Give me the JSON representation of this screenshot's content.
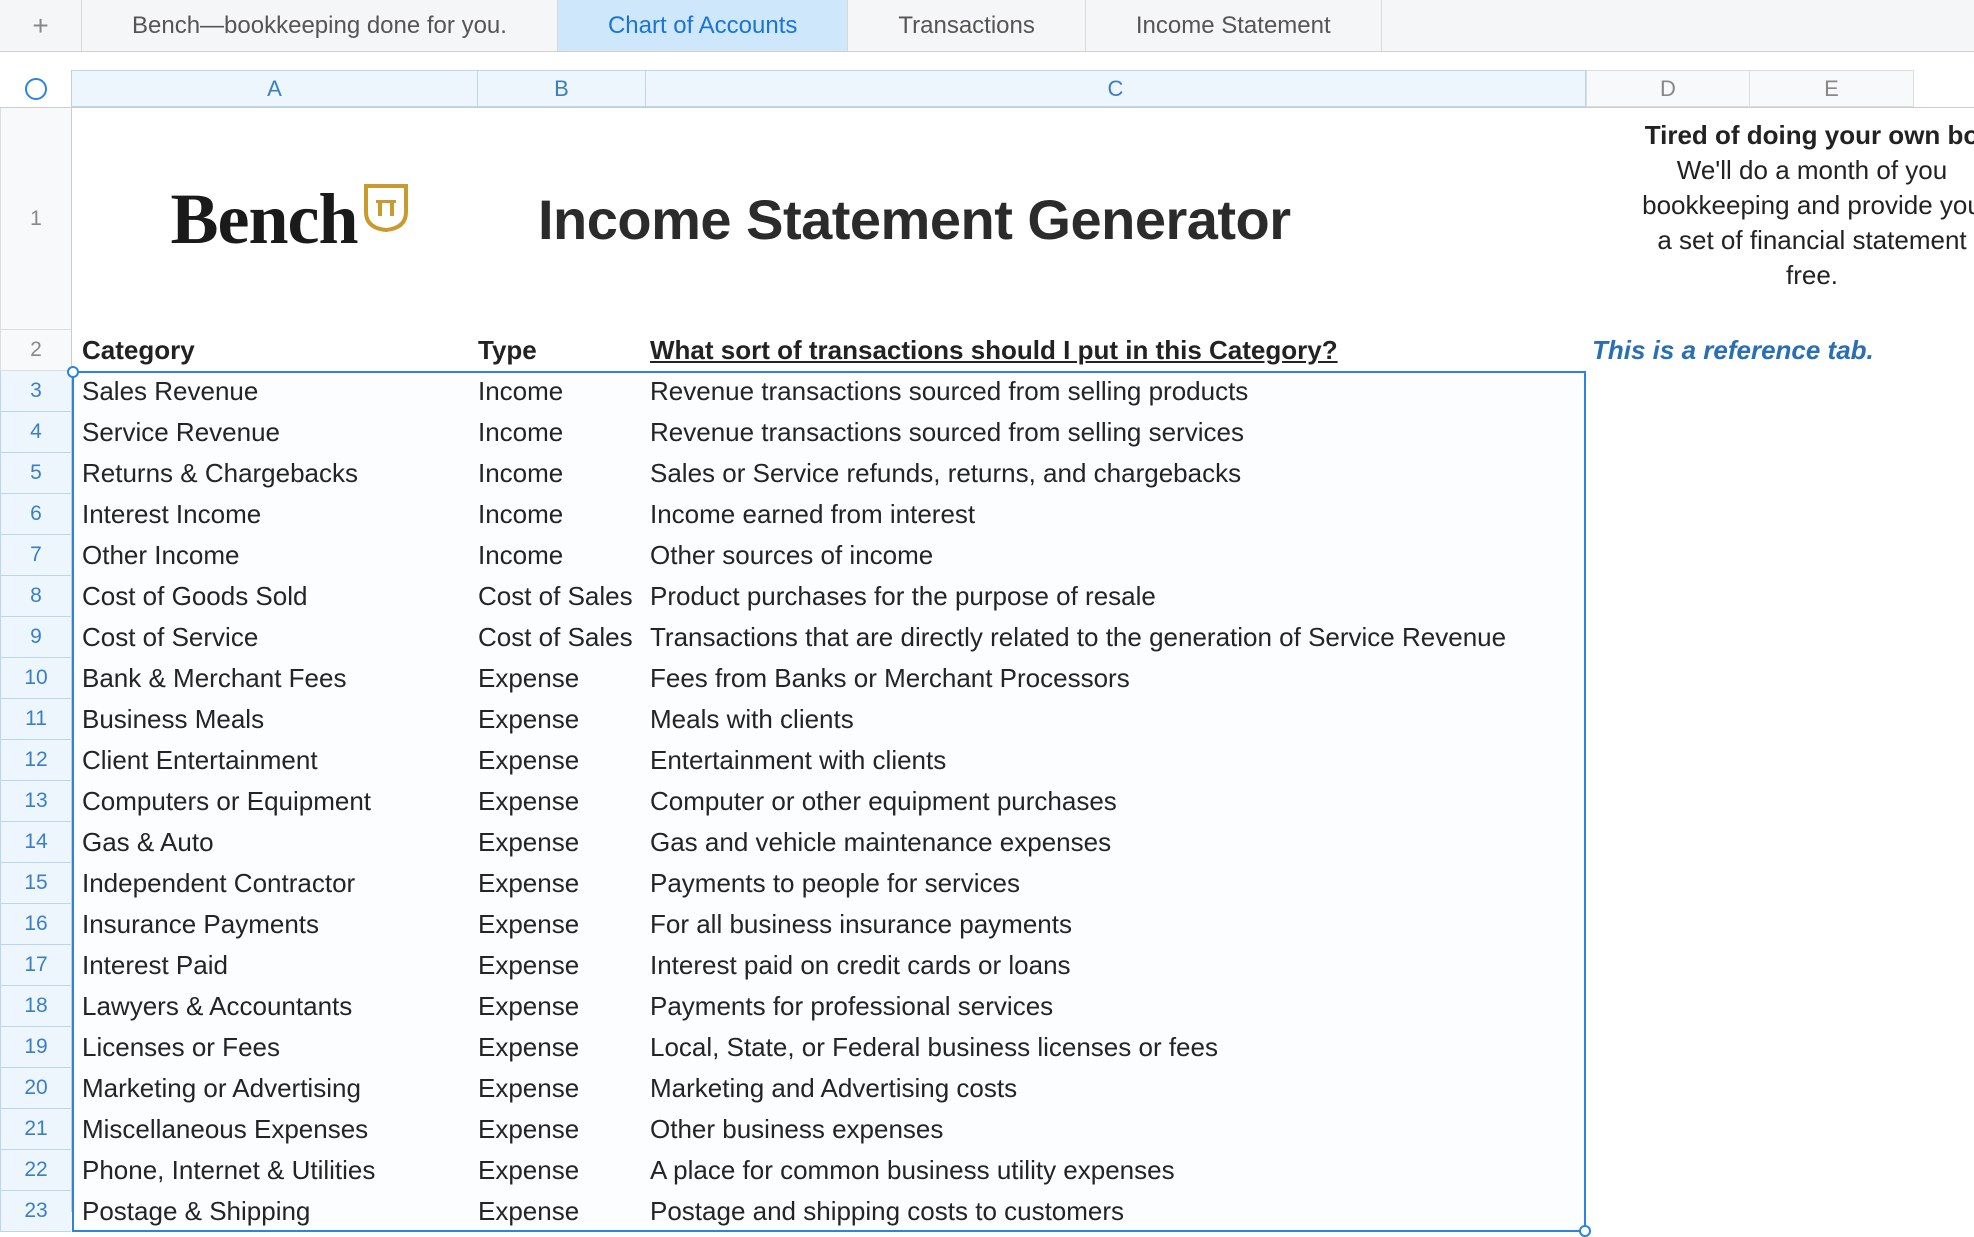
{
  "tabs": {
    "items": [
      {
        "label": "Bench—bookkeeping done for you.",
        "active": false
      },
      {
        "label": "Chart of Accounts",
        "active": true
      },
      {
        "label": "Transactions",
        "active": false
      },
      {
        "label": "Income Statement",
        "active": false
      }
    ]
  },
  "columns": [
    "A",
    "B",
    "C",
    "D",
    "E"
  ],
  "row1": {
    "logo_text": "Bench",
    "title": "Income Statement Generator",
    "promo_bold": "Tired of doing your own bo",
    "promo_lines": [
      "We'll do a month of you",
      "bookkeeping and provide you",
      "a set of financial statement",
      "free."
    ]
  },
  "headers": {
    "category": "Category",
    "type": "Type",
    "desc": "What sort of transactions should I put in this Category?",
    "ref_note": "This is a reference tab."
  },
  "rows": [
    {
      "n": 3,
      "cat": "Sales Revenue",
      "type": "Income",
      "desc": "Revenue transactions sourced from selling products"
    },
    {
      "n": 4,
      "cat": "Service Revenue",
      "type": "Income",
      "desc": "Revenue transactions sourced from selling services"
    },
    {
      "n": 5,
      "cat": "Returns & Chargebacks",
      "type": "Income",
      "desc": "Sales or Service refunds, returns, and chargebacks"
    },
    {
      "n": 6,
      "cat": "Interest Income",
      "type": "Income",
      "desc": "Income earned from interest"
    },
    {
      "n": 7,
      "cat": "Other Income",
      "type": "Income",
      "desc": "Other sources of income"
    },
    {
      "n": 8,
      "cat": "Cost of Goods Sold",
      "type": "Cost of Sales",
      "desc": "Product purchases for the purpose of resale"
    },
    {
      "n": 9,
      "cat": "Cost of Service",
      "type": "Cost of Sales",
      "desc": "Transactions that are directly related to the generation of Service Revenue"
    },
    {
      "n": 10,
      "cat": "Bank & Merchant Fees",
      "type": "Expense",
      "desc": "Fees from Banks or Merchant Processors"
    },
    {
      "n": 11,
      "cat": "Business Meals",
      "type": "Expense",
      "desc": "Meals with clients"
    },
    {
      "n": 12,
      "cat": "Client Entertainment",
      "type": "Expense",
      "desc": "Entertainment with clients"
    },
    {
      "n": 13,
      "cat": "Computers or Equipment",
      "type": "Expense",
      "desc": "Computer or other equipment purchases"
    },
    {
      "n": 14,
      "cat": "Gas & Auto",
      "type": "Expense",
      "desc": "Gas and vehicle maintenance expenses"
    },
    {
      "n": 15,
      "cat": "Independent Contractor",
      "type": "Expense",
      "desc": "Payments to people for services"
    },
    {
      "n": 16,
      "cat": "Insurance Payments",
      "type": "Expense",
      "desc": "For all business insurance payments"
    },
    {
      "n": 17,
      "cat": "Interest Paid",
      "type": "Expense",
      "desc": "Interest paid on credit cards or loans"
    },
    {
      "n": 18,
      "cat": "Lawyers & Accountants",
      "type": "Expense",
      "desc": "Payments for professional services"
    },
    {
      "n": 19,
      "cat": "Licenses or Fees",
      "type": "Expense",
      "desc": "Local, State, or Federal business licenses or fees"
    },
    {
      "n": 20,
      "cat": "Marketing or Advertising",
      "type": "Expense",
      "desc": "Marketing and Advertising costs"
    },
    {
      "n": 21,
      "cat": "Miscellaneous Expenses",
      "type": "Expense",
      "desc": "Other business expenses"
    },
    {
      "n": 22,
      "cat": "Phone, Internet & Utilities",
      "type": "Expense",
      "desc": "A place for common business utility expenses"
    },
    {
      "n": 23,
      "cat": "Postage & Shipping",
      "type": "Expense",
      "desc": "Postage and shipping costs to customers"
    }
  ]
}
